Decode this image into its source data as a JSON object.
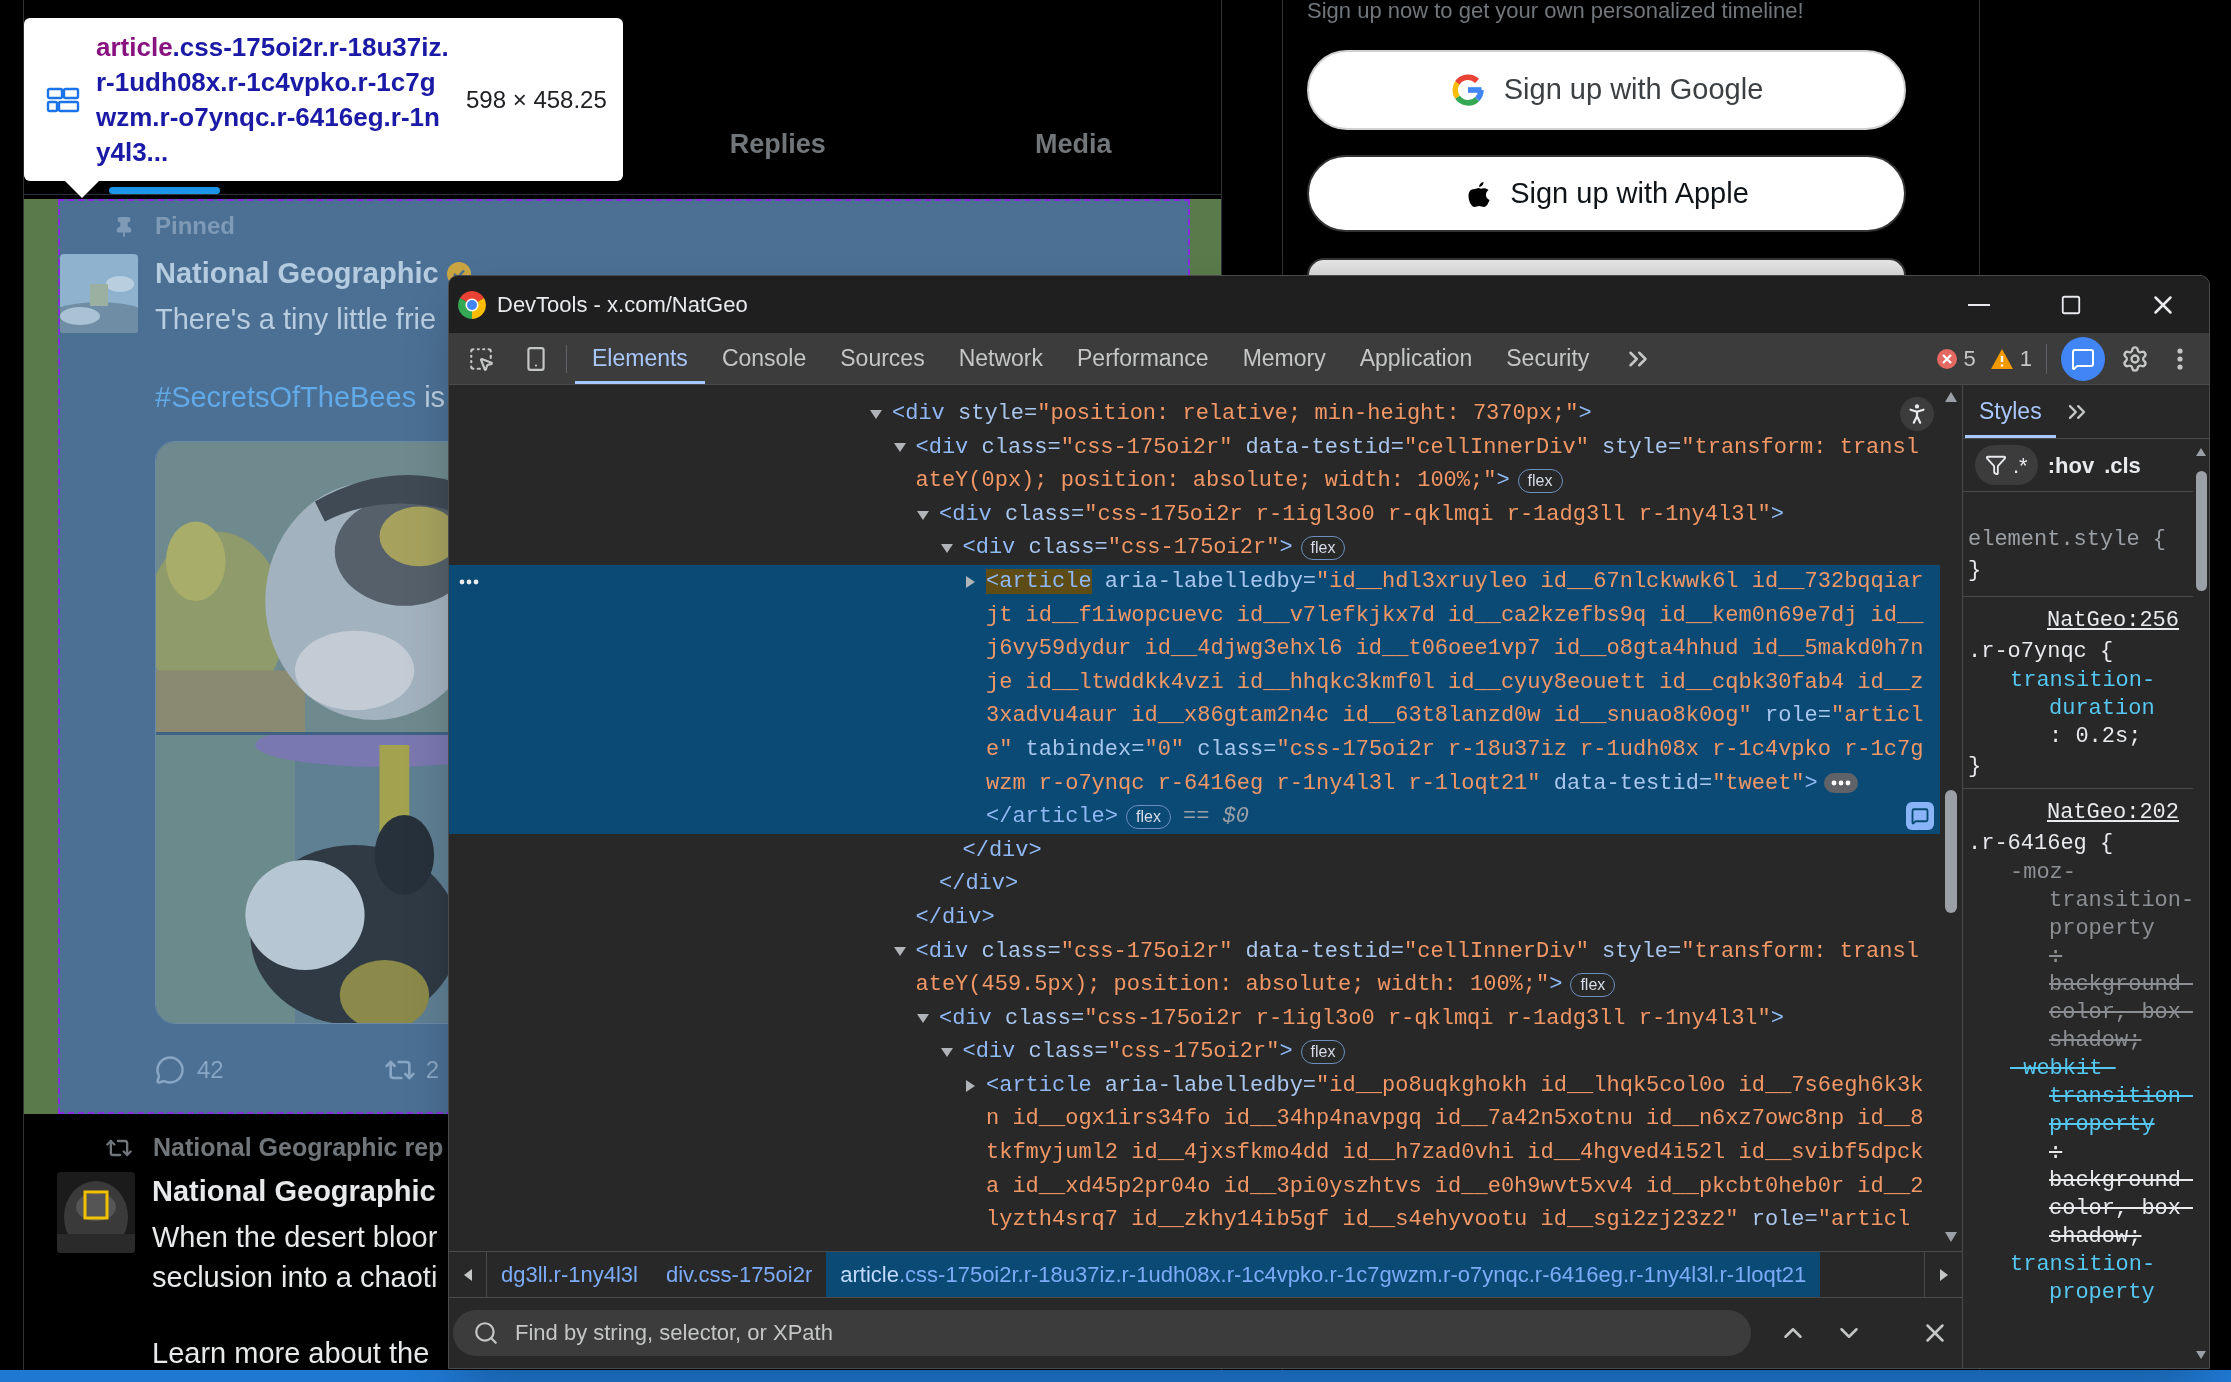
{
  "page": {
    "tooltip": {
      "tag": "article",
      "classes": ".css-175oi2r.r-18u37iz.r-1udh08x.r-1c4vpko.r-1c7gwzm.r-o7ynqc.r-6416eg.r-1ny4l3...",
      "size": "598 × 458.25"
    },
    "feed_tabs": [
      {
        "label": "Replies",
        "selected": false
      },
      {
        "label": "Media",
        "selected": false
      }
    ],
    "pinned_post": {
      "pinned_label": "Pinned",
      "author": "National Geographic",
      "text": "There's a tiny little frie",
      "hashtag": "#SecretsOfTheBees",
      "text_after": "is",
      "replies": "42",
      "reposts": "2"
    },
    "reposted_post": {
      "repost_label": "National Geographic rep",
      "author": "National Geographic",
      "lines": [
        "When the desert bloor",
        "seclusion into a chaoti"
      ],
      "more": "Learn more about the"
    },
    "signup": {
      "prompt": "Sign up now to get your own personalized timeline!",
      "buttons": [
        {
          "kind": "google",
          "label": "Sign up with Google"
        },
        {
          "kind": "apple",
          "label": "Sign up with Apple"
        },
        {
          "kind": "partial"
        }
      ]
    }
  },
  "devtools": {
    "title": "DevTools - x.com/NatGeo",
    "tabs": [
      {
        "label": "Elements",
        "selected": true
      },
      {
        "label": "Console",
        "selected": false
      },
      {
        "label": "Sources",
        "selected": false
      },
      {
        "label": "Network",
        "selected": false
      },
      {
        "label": "Performance",
        "selected": false
      },
      {
        "label": "Memory",
        "selected": false
      },
      {
        "label": "Application",
        "selected": false
      },
      {
        "label": "Security",
        "selected": false
      }
    ],
    "errors": "5",
    "warnings": "1",
    "tree": [
      {
        "open": "<div style=\"position: relative; min-height: 7370px;\">",
        "expanded": true,
        "selected": false,
        "tag_highlighted": false,
        "children": [
          {
            "open": "<div class=\"css-175oi2r\" data-testid=\"cellInnerDiv\" style=\"transform: translateY(0px); position: absolute; width: 100%;\">",
            "badge": "flex",
            "expanded": true,
            "selected": false,
            "tag_highlighted": false,
            "close": "</div>",
            "children": [
              {
                "open": "<div class=\"css-175oi2r r-1igl3o0 r-qklmqi r-1adg3ll r-1ny4l3l\">",
                "expanded": true,
                "selected": false,
                "tag_highlighted": false,
                "close": "</div>",
                "children": [
                  {
                    "open": "<div class=\"css-175oi2r\">",
                    "badge": "flex",
                    "expanded": true,
                    "selected": false,
                    "tag_highlighted": false,
                    "close": "</div>",
                    "children": [
                      {
                        "open": "<article aria-labelledby=\"id__hdl3xruyleo id__67nlckwwk6l id__732bqqiarjt id__f1iwopcuevc id__v7lefkjkx7d id__ca2kzefbs9q id__kem0n69e7dj id__j6vy59dydur id__4djwg3ehxl6 id__t06oee1vp7 id__o8gta4hhud id__5makd0h7nje id__ltwddkk4vzi id__hhqkc3kmf0l id__cyuy8eouett id__cqbk30fab4 id__z3xadvu4aur id__x86gtam2n4c id__63t8lanzd0w id__snuao8k0og\" role=\"article\" tabindex=\"0\" class=\"css-175oi2r r-18u37iz r-1udh08x r-1c4vpko r-1c7gwzm r-o7ynqc r-6416eg r-1ny4l3l r-1loqt21\" data-testid=\"tweet\">",
                        "expanded": false,
                        "selected": true,
                        "tag_highlighted": true,
                        "close": "</article>",
                        "badge": "flex",
                        "console_ref": "== *$0*"
                      }
                    ]
                  }
                ]
              }
            ]
          },
          {
            "open": "<div class=\"css-175oi2r\" data-testid=\"cellInnerDiv\" style=\"transform: translateY(459.5px); position: absolute; width: 100%;\">",
            "badge": "flex",
            "expanded": true,
            "selected": false,
            "tag_highlighted": false,
            "children": [
              {
                "open": "<div class=\"css-175oi2r r-1igl3o0 r-qklmqi r-1adg3ll r-1ny4l3l\">",
                "expanded": true,
                "selected": false,
                "tag_highlighted": false,
                "children": [
                  {
                    "open": "<div class=\"css-175oi2r\">",
                    "badge": "flex",
                    "expanded": true,
                    "selected": false,
                    "tag_highlighted": false,
                    "children": [
                      {
                        "open": "<article aria-labelledby=\"id__po8uqkghokh id__lhqk5col0o id__7s6egh6k3kn id__ogx1irs34fo id__34hp4navpgq id__7a42n5xotnu id__n6xz7owc8np id__8tkfmyjuml2 id__4jxsfkmo4dd id__h7zad0vhi id__4hgved4i52l id__svibf5dpcka id__xd45p2pr04o id__3pi0yszhtvs id__e0h9wvt5xv4 id__pkcbt0heb0r id__2lyzth4srq7 id__zkhy14ib5gf id__s4ehyvootu id__sgi2zj23z2\" role=\"articl",
                        "expanded": false,
                        "selected": false,
                        "tag_highlighted": false
                      }
                    ]
                  }
                ]
              }
            ]
          }
        ]
      }
    ],
    "breadcrumbs": [
      {
        "text": "dg3ll.r-1ny4l3l",
        "selected": false
      },
      {
        "text": "div.css-175oi2r",
        "selected": false
      },
      {
        "text": "article.css-175oi2r.r-18u37iz.r-1udh08x.r-1c4vpko.r-1c7gwzm.r-o7ynqc.r-6416eg.r-1ny4l3l.r-1loqt21",
        "selected": true
      }
    ],
    "find_placeholder": "Find by string, selector, or XPath",
    "styles": {
      "tabs": [
        {
          "label": "Styles",
          "selected": true
        }
      ],
      "regex_toggle": ".*",
      "hov": ":hov",
      "cls": ".cls",
      "rules": [
        {
          "selector": "element.style {",
          "close": "}"
        },
        {
          "source": "NatGeo:256",
          "selector": ".r-o7ynqc {",
          "declarations": [
            {
              "name": "transition-duration",
              "value": ": 0.2s;",
              "inactive": false,
              "overridden": false
            }
          ],
          "close": "}"
        },
        {
          "source": "NatGeo:202",
          "selector": ".r-6416eg {",
          "declarations": [
            {
              "name": "-moz-transition-property",
              "value": ": background-color, box-shadow;",
              "inactive": true,
              "overridden": false
            },
            {
              "name": "-webkit-transition-property",
              "value": ": background-color, box-shadow;",
              "inactive": false,
              "overridden": true
            },
            {
              "name": "transition-property",
              "inactive": false,
              "overridden": false
            }
          ]
        }
      ]
    }
  }
}
